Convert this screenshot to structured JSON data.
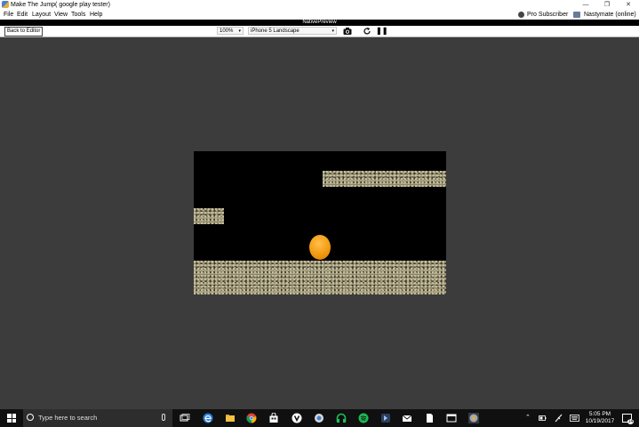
{
  "window": {
    "title": "Make The Jump( google play tester)",
    "controls": [
      "—",
      "❐",
      "✕"
    ]
  },
  "menu": {
    "items": [
      "File",
      "Edit",
      "Layout",
      "View",
      "Tools",
      "Help"
    ],
    "pro_label": "Pro Subscriber",
    "user_label": "Nastymate (online)"
  },
  "preview": {
    "panel_title": "NativePreview",
    "back_button": "Back to Editor",
    "zoom_value": "100%",
    "device_value": "iPhone 5 Landscape",
    "dropdown_arrow": "▾",
    "pause_glyph": "❚❚"
  },
  "game": {
    "background": "#000000",
    "ball_color": "#f39a12",
    "stone_color": "#8a8468"
  },
  "taskbar": {
    "search_placeholder": "Type here to search",
    "time": "5:05 PM",
    "date": "10/19/2017",
    "notification_count": "14",
    "apps": [
      "task-view-icon",
      "edge-icon",
      "file-explorer-icon",
      "chrome-icon",
      "store-icon",
      "vivaldi-icon",
      "app-green-icon",
      "spotify-icon",
      "app-dark-icon",
      "mail-icon",
      "file-icon",
      "app-window-icon",
      "buildbox-icon"
    ]
  },
  "colors": {
    "workspace": "#3c3c3c",
    "taskbar": "#101010",
    "active_indicator": "#e04848"
  }
}
